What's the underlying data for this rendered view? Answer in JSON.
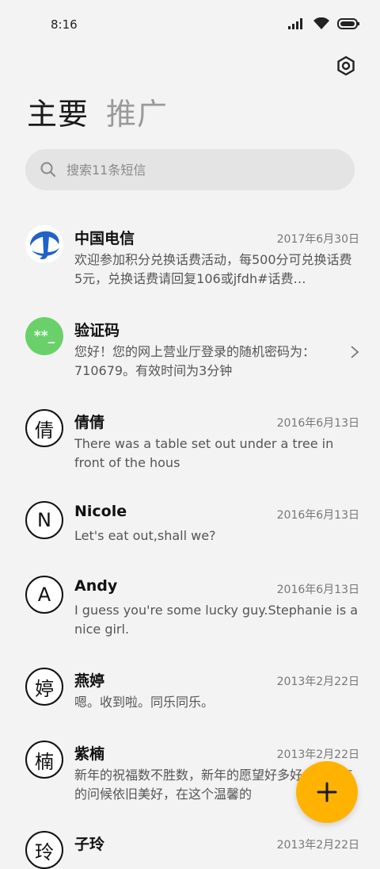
{
  "status_bar": {
    "time": "8:16"
  },
  "tabs": [
    {
      "label": "主要",
      "active": true
    },
    {
      "label": "推广",
      "active": false
    }
  ],
  "search": {
    "placeholder": "搜索11条短信"
  },
  "conversations": [
    {
      "name": "中国电信",
      "date": "2017年6月30日",
      "preview": "欢迎参加积分兑换话费活动，每500分可兑换话费5元，兑换话费请回复106或jfdh#话费…",
      "avatar": "telecom-logo"
    },
    {
      "name": "验证码",
      "date": "",
      "preview": "您好！您的网上营业厅登录的随机密码为：710679。有效时间为3分钟",
      "avatar": "**_"
    },
    {
      "name": "倩倩",
      "date": "2016年6月13日",
      "preview": "There was a table set out under a tree in front of the hous",
      "avatar": "倩"
    },
    {
      "name": "Nicole",
      "date": "2016年6月13日",
      "preview": "Let's eat out,shall we?",
      "avatar": "N"
    },
    {
      "name": "Andy",
      "date": "2016年6月13日",
      "preview": "I guess you're some lucky guy.Stephanie is a nice girl.",
      "avatar": "A"
    },
    {
      "name": "燕婷",
      "date": "2013年2月22日",
      "preview": "嗯。收到啦。同乐同乐。",
      "avatar": "婷"
    },
    {
      "name": "紫楠",
      "date": "2013年2月22日",
      "preview": "新年的祝福数不胜数，新年的愿望好多好多，新年的问候依旧美好，在这个温馨的",
      "avatar": "楠"
    },
    {
      "name": "子玲",
      "date": "2013年2月22日",
      "preview": "",
      "avatar": "玲"
    }
  ],
  "fab": {
    "icon": "plus-icon",
    "color": "#ffb300"
  }
}
